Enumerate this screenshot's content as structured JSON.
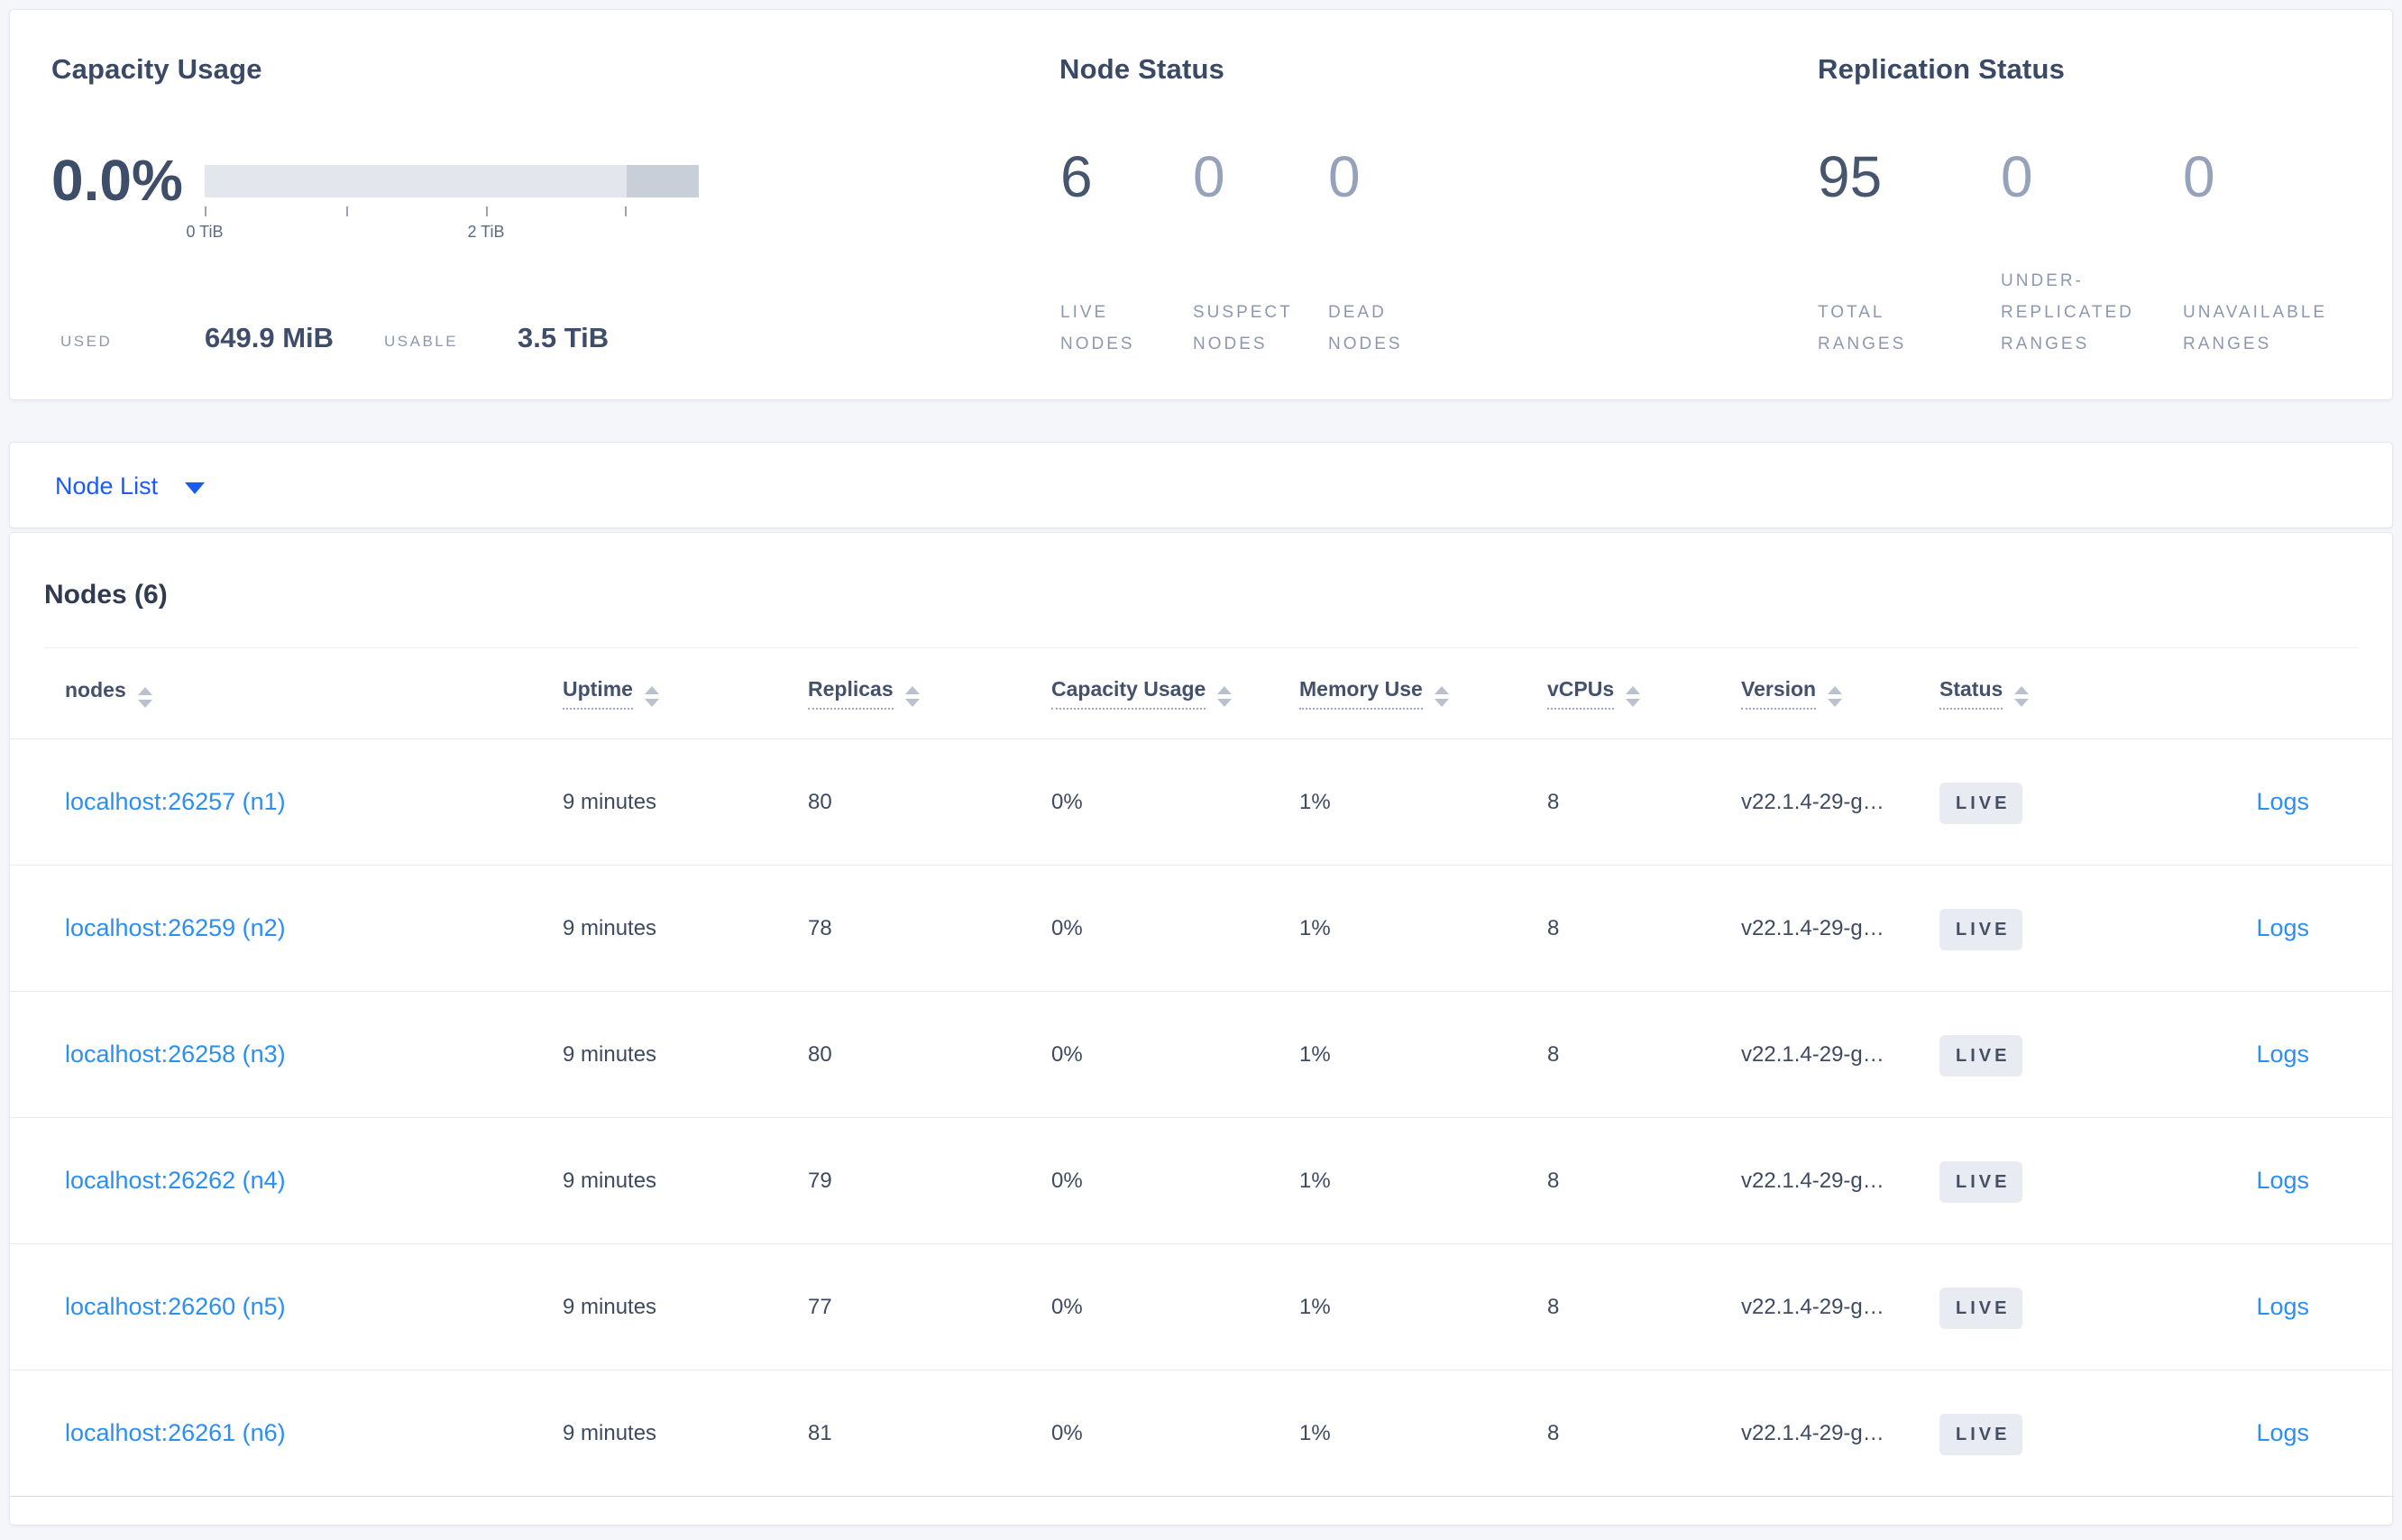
{
  "summary": {
    "capacity": {
      "title": "Capacity Usage",
      "percent": "0.0%",
      "axis_ticks": [
        "0 TiB",
        "2 TiB"
      ],
      "used_label": "USED",
      "used_value": "649.9 MiB",
      "usable_label": "USABLE",
      "usable_value": "3.5 TiB"
    },
    "node_status": {
      "title": "Node Status",
      "stats": [
        {
          "value": "6",
          "lines": [
            "LIVE",
            "NODES"
          ]
        },
        {
          "value": "0",
          "lines": [
            "SUSPECT",
            "NODES"
          ]
        },
        {
          "value": "0",
          "lines": [
            "DEAD",
            "NODES"
          ]
        }
      ]
    },
    "replication": {
      "title": "Replication Status",
      "stats": [
        {
          "value": "95",
          "lines": [
            "TOTAL",
            "RANGES"
          ]
        },
        {
          "value": "0",
          "lines": [
            "UNDER-",
            "REPLICATED",
            "RANGES"
          ]
        },
        {
          "value": "0",
          "lines": [
            "UNAVAILABLE",
            "RANGES"
          ]
        }
      ]
    }
  },
  "node_list": {
    "label": "Node List"
  },
  "nodes_table": {
    "title": "Nodes (6)",
    "columns": [
      {
        "label": "nodes"
      },
      {
        "label": "Uptime"
      },
      {
        "label": "Replicas"
      },
      {
        "label": "Capacity Usage"
      },
      {
        "label": "Memory Use"
      },
      {
        "label": "vCPUs"
      },
      {
        "label": "Version"
      },
      {
        "label": "Status"
      }
    ],
    "logs_label": "Logs",
    "rows": [
      {
        "name": "localhost:26257 (n1)",
        "uptime": "9 minutes",
        "replicas": "80",
        "capacity": "0%",
        "memory": "1%",
        "vcpus": "8",
        "version": "v22.1.4-29-g…",
        "status": "LIVE"
      },
      {
        "name": "localhost:26259 (n2)",
        "uptime": "9 minutes",
        "replicas": "78",
        "capacity": "0%",
        "memory": "1%",
        "vcpus": "8",
        "version": "v22.1.4-29-g…",
        "status": "LIVE"
      },
      {
        "name": "localhost:26258 (n3)",
        "uptime": "9 minutes",
        "replicas": "80",
        "capacity": "0%",
        "memory": "1%",
        "vcpus": "8",
        "version": "v22.1.4-29-g…",
        "status": "LIVE"
      },
      {
        "name": "localhost:26262 (n4)",
        "uptime": "9 minutes",
        "replicas": "79",
        "capacity": "0%",
        "memory": "1%",
        "vcpus": "8",
        "version": "v22.1.4-29-g…",
        "status": "LIVE"
      },
      {
        "name": "localhost:26260 (n5)",
        "uptime": "9 minutes",
        "replicas": "77",
        "capacity": "0%",
        "memory": "1%",
        "vcpus": "8",
        "version": "v22.1.4-29-g…",
        "status": "LIVE"
      },
      {
        "name": "localhost:26261 (n6)",
        "uptime": "9 minutes",
        "replicas": "81",
        "capacity": "0%",
        "memory": "1%",
        "vcpus": "8",
        "version": "v22.1.4-29-g…",
        "status": "LIVE"
      }
    ]
  },
  "colors": {
    "link_blue": "#2b8ff2",
    "dropdown_blue": "#1a5cf3",
    "stat_dark": "#46566f",
    "stat_dim": "#96a1ba",
    "badge_bg": "#e8ebf2",
    "bar_track": "#e3e6ec",
    "bar_reserved": "#c9cfd9",
    "page_bg": "#f4f6fa"
  }
}
